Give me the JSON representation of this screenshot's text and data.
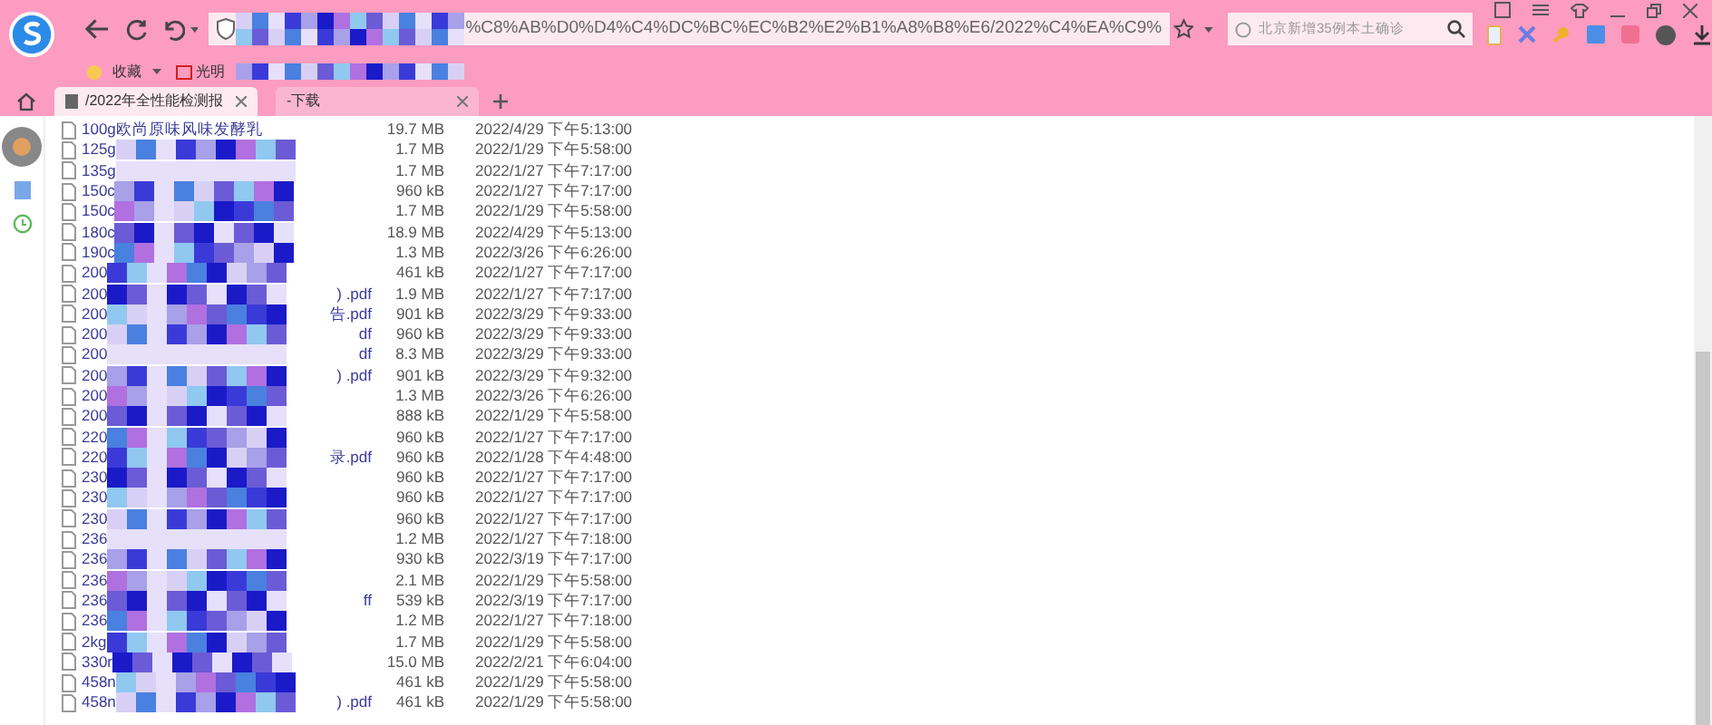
{
  "address_bar": {
    "value": "%C8%AB%D0%D4%C4%DC%BC%EC%B2%E2%B1%A8%B8%E6/2022%C4%EA%C9%"
  },
  "search_bar": {
    "placeholder": "北京新增35例本土确诊"
  },
  "bookmarks": [
    {
      "label": "收藏"
    },
    {
      "label": "光明"
    }
  ],
  "tabs": [
    {
      "title": "/2022年全性能检测报",
      "selected": true
    },
    {
      "title": "-下载",
      "selected": false
    }
  ],
  "files": [
    {
      "name": "100g欧尚原味风味发酵乳",
      "masked": false,
      "size": "19.7 MB",
      "modified": "2022/4/29 下午5:13:00"
    },
    {
      "name": "125g",
      "masked": true,
      "size": "1.7 MB",
      "modified": "2022/1/29 下午5:58:00"
    },
    {
      "name": "135g",
      "masked": true,
      "size": "1.7 MB",
      "modified": "2022/1/27 下午7:17:00"
    },
    {
      "name": "150c",
      "masked": true,
      "size": "960 kB",
      "modified": "2022/1/27 下午7:17:00"
    },
    {
      "name": "150c",
      "masked": true,
      "size": "1.7 MB",
      "modified": "2022/1/29 下午5:58:00"
    },
    {
      "name": "180c",
      "masked": true,
      "size": "18.9 MB",
      "modified": "2022/4/29 下午5:13:00"
    },
    {
      "name": "190c",
      "masked": true,
      "size": "1.3 MB",
      "modified": "2022/3/26 下午6:26:00"
    },
    {
      "name": "200",
      "masked": true,
      "size": "461 kB",
      "modified": "2022/1/27 下午7:17:00"
    },
    {
      "name": "200",
      "suffix": ") .pdf",
      "masked": true,
      "size": "1.9 MB",
      "modified": "2022/1/27 下午7:17:00"
    },
    {
      "name": "200",
      "suffix": "告.pdf",
      "masked": true,
      "size": "901 kB",
      "modified": "2022/3/29 下午9:33:00"
    },
    {
      "name": "200",
      "suffix": "df",
      "masked": true,
      "size": "960 kB",
      "modified": "2022/3/29 下午9:33:00"
    },
    {
      "name": "200",
      "suffix": "df",
      "masked": true,
      "size": "8.3 MB",
      "modified": "2022/3/29 下午9:33:00"
    },
    {
      "name": "200",
      "suffix": ") .pdf",
      "masked": true,
      "size": "901 kB",
      "modified": "2022/3/29 下午9:32:00"
    },
    {
      "name": "200",
      "masked": true,
      "size": "1.3 MB",
      "modified": "2022/3/26 下午6:26:00"
    },
    {
      "name": "200",
      "masked": true,
      "size": "888 kB",
      "modified": "2022/1/29 下午5:58:00"
    },
    {
      "name": "220",
      "masked": true,
      "size": "960 kB",
      "modified": "2022/1/27 下午7:17:00"
    },
    {
      "name": "220",
      "suffix": "录.pdf",
      "masked": true,
      "size": "960 kB",
      "modified": "2022/1/28 下午4:48:00"
    },
    {
      "name": "230",
      "masked": true,
      "size": "960 kB",
      "modified": "2022/1/27 下午7:17:00"
    },
    {
      "name": "230",
      "masked": true,
      "size": "960 kB",
      "modified": "2022/1/27 下午7:17:00"
    },
    {
      "name": "230",
      "masked": true,
      "size": "960 kB",
      "modified": "2022/1/27 下午7:17:00"
    },
    {
      "name": "236",
      "masked": true,
      "size": "1.2 MB",
      "modified": "2022/1/27 下午7:18:00"
    },
    {
      "name": "236",
      "masked": true,
      "size": "930 kB",
      "modified": "2022/3/19 下午7:17:00"
    },
    {
      "name": "236",
      "masked": true,
      "size": "2.1 MB",
      "modified": "2022/1/29 下午5:58:00"
    },
    {
      "name": "236",
      "suffix": "ff",
      "masked": true,
      "size": "539 kB",
      "modified": "2022/3/19 下午7:17:00"
    },
    {
      "name": "236",
      "masked": true,
      "size": "1.2 MB",
      "modified": "2022/1/27 下午7:18:00"
    },
    {
      "name": "2kg",
      "masked": true,
      "size": "1.7 MB",
      "modified": "2022/1/29 下午5:58:00"
    },
    {
      "name": "330r",
      "masked": true,
      "size": "15.0 MB",
      "modified": "2022/2/21 下午6:04:00"
    },
    {
      "name": "458n",
      "masked": true,
      "size": "461 kB",
      "modified": "2022/1/29 下午5:58:00"
    },
    {
      "name": "458n",
      "suffix": ") .pdf",
      "masked": true,
      "size": "461 kB",
      "modified": "2022/1/29 下午5:58:00"
    }
  ]
}
